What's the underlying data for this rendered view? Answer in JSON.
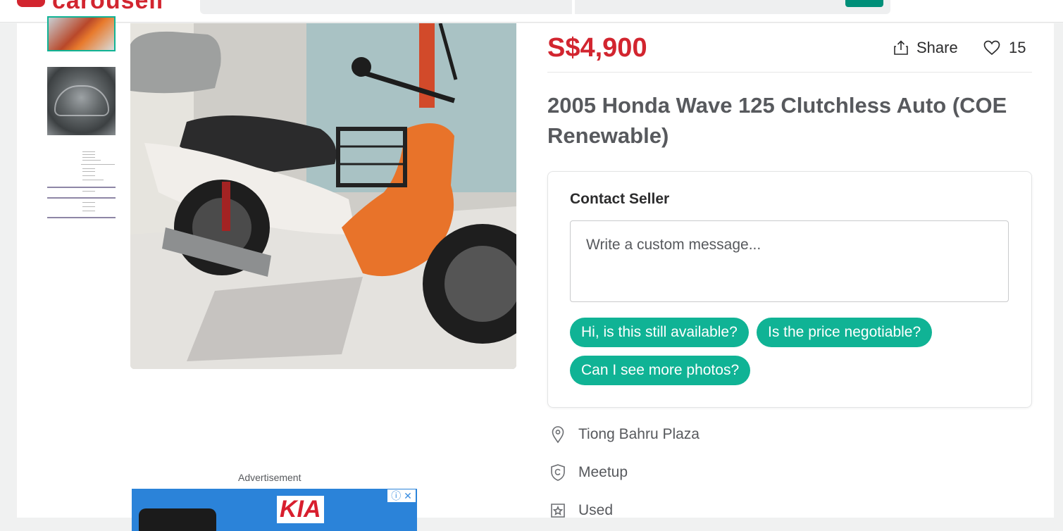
{
  "header": {
    "logo_text": "carousell"
  },
  "listing": {
    "price": "S$4,900",
    "share_label": "Share",
    "like_count": "15",
    "title": "2005 Honda Wave 125 Clutchless Auto (COE Renewable)"
  },
  "contact": {
    "heading": "Contact Seller",
    "placeholder": "Write a custom message...",
    "quick_replies": [
      "Hi, is this still available?",
      "Is the price negotiable?",
      "Can I see more photos?"
    ]
  },
  "details": {
    "location": "Tiong Bahru Plaza",
    "deal_method": "Meetup",
    "condition": "Used"
  },
  "ad": {
    "label": "Advertisement",
    "brand": "KIA"
  },
  "colors": {
    "price": "#d2252f",
    "accent": "#10b395"
  }
}
